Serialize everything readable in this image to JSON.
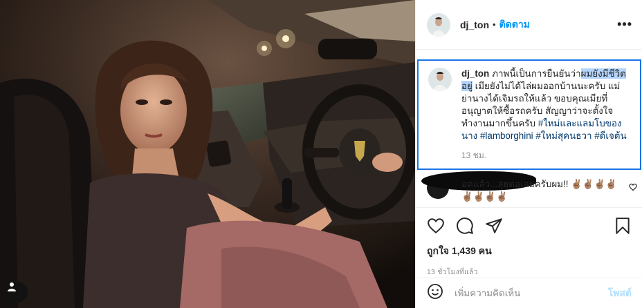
{
  "post": {
    "username": "dj_ton",
    "separator": "•",
    "follow_label": "ติดตาม",
    "more_label": "•••"
  },
  "caption": {
    "username": "dj_ton",
    "text_before": "ภาพนี้เป็นการยืนยันว่า",
    "text_highlight": "ผมยังมีชีวิตอยู่",
    "text_after": " เมียยังไม่ได้ไล่ผมออกบ้านนะครับ แม่ย่านางได้เจิมรถให้แล้ว ขอบคุณเมียที่อนุญาตให้ซื้อรถครับ สัญญาว่าจะตั้งใจทำงานมากขึ้นครับ ",
    "hashtags": [
      "#ใหม่และแลมโบของนาง",
      "#lamborghini",
      "#ใหม่สุคนธวา",
      "#ดีเจต้น"
    ],
    "time": "13 ชม."
  },
  "comment": {
    "text": "อดแล้ว...ลุยต่อเลยครับผม!! ✌🏽✌🏽✌🏽✌🏽✌🏽✌🏽✌🏽✌🏽"
  },
  "actions": {
    "likes": "ถูกใจ 1,439 คน",
    "ago": "13 ชั่วโมงที่แล้ว"
  },
  "add_comment": {
    "placeholder": "เพิ่มความคิดเห็น",
    "post_label": "โพสต์"
  }
}
